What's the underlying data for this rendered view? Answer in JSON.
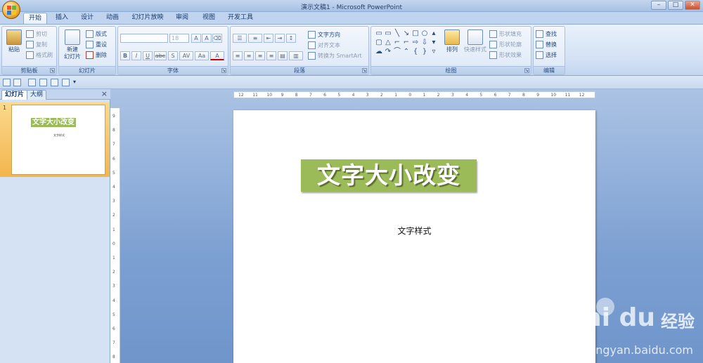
{
  "window": {
    "title": "演示文稿1 - Microsoft PowerPoint",
    "min": "–",
    "max": "□",
    "close": "✕"
  },
  "tabs": [
    "开始",
    "插入",
    "设计",
    "动画",
    "幻灯片放映",
    "审阅",
    "视图",
    "开发工具"
  ],
  "ribbon": {
    "clipboard": {
      "label": "剪贴板",
      "paste": "粘贴",
      "cut": "剪切",
      "copy": "复制",
      "format_painter": "格式刷"
    },
    "slides": {
      "label": "幻灯片",
      "new_slide": "新建\n幻灯片",
      "layout": "版式",
      "reset": "重设",
      "delete": "删除"
    },
    "font": {
      "label": "字体",
      "font_name": "",
      "font_size": "18",
      "bold": "B",
      "italic": "I",
      "underline": "U",
      "strike": "abc",
      "shadow": "S",
      "spacing": "AV",
      "case": "Aa",
      "color": "A",
      "grow": "A",
      "shrink": "A"
    },
    "paragraph": {
      "label": "段落",
      "text_direction": "文字方向",
      "align_text": "对齐文本",
      "smartart": "转换为 SmartArt"
    },
    "drawing": {
      "label": "绘图",
      "arrange": "排列",
      "quick_styles": "快速样式",
      "shape_fill": "形状填充",
      "shape_outline": "形状轮廓",
      "shape_effects": "形状效果"
    },
    "editing": {
      "label": "编辑",
      "find": "查找",
      "replace": "替换",
      "select": "选择"
    }
  },
  "pane": {
    "tab_slides": "幻灯片",
    "tab_outline": "大纲",
    "close": "×",
    "slide_number": "1"
  },
  "slide": {
    "title": "文字大小改变",
    "subtitle": "文字样式"
  },
  "ruler": {
    "h_ticks": [
      "12",
      "11",
      "10",
      "9",
      "8",
      "7",
      "6",
      "5",
      "4",
      "3",
      "2",
      "1",
      "0",
      "1",
      "2",
      "3",
      "4",
      "5",
      "6",
      "7",
      "8",
      "9",
      "10",
      "11",
      "12"
    ],
    "v_ticks": [
      "9",
      "8",
      "7",
      "6",
      "5",
      "4",
      "3",
      "2",
      "1",
      "0",
      "1",
      "2",
      "3",
      "4",
      "5",
      "6",
      "7",
      "8"
    ]
  },
  "watermark": {
    "brand": "Bai  du",
    "product": "经验",
    "url": "jingyan.baidu.com"
  }
}
